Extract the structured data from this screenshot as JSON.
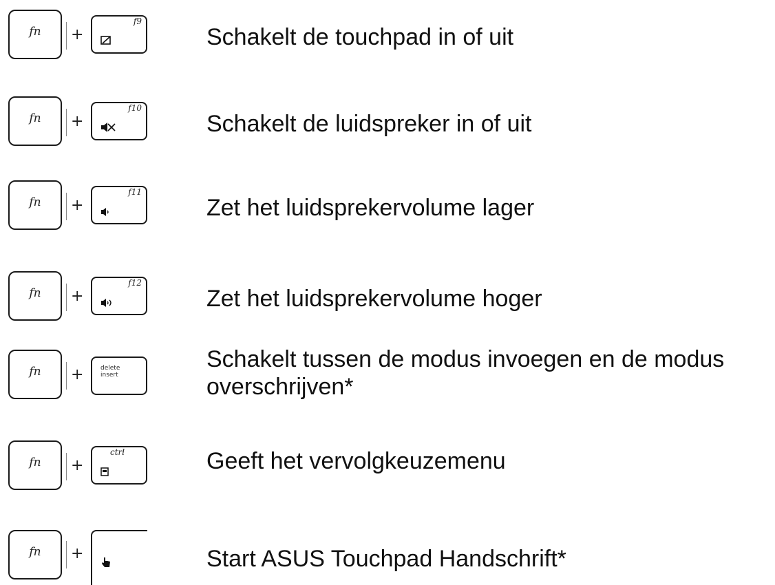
{
  "rows": [
    {
      "fn": "fn",
      "plus": "+",
      "key_label": "f9",
      "key_icon": "touchpad-icon",
      "description": "Schakelt de touchpad in of uit"
    },
    {
      "fn": "fn",
      "plus": "+",
      "key_label": "f10",
      "key_icon": "speaker-mute-icon",
      "description": "Schakelt de luidspreker in of uit"
    },
    {
      "fn": "fn",
      "plus": "+",
      "key_label": "f11",
      "key_icon": "volume-down-icon",
      "description": "Zet het luidsprekervolume lager"
    },
    {
      "fn": "fn",
      "plus": "+",
      "key_label": "f12",
      "key_icon": "volume-up-icon",
      "description": "Zet het luidsprekervolume hoger"
    },
    {
      "fn": "fn",
      "plus": "+",
      "key_label": "delete",
      "key_sublabel": "insert",
      "key_icon": "",
      "description": "Schakelt tussen de modus invoegen en de modus overschrijven*"
    },
    {
      "fn": "fn",
      "plus": "+",
      "key_label": "ctrl",
      "key_icon": "menu-icon",
      "description": "Geeft het vervolgkeuzemenu"
    },
    {
      "fn": "fn",
      "plus": "+",
      "key_label": "",
      "key_icon": "handwriting-icon",
      "description": "Start ASUS Touchpad Handschrift*"
    }
  ]
}
